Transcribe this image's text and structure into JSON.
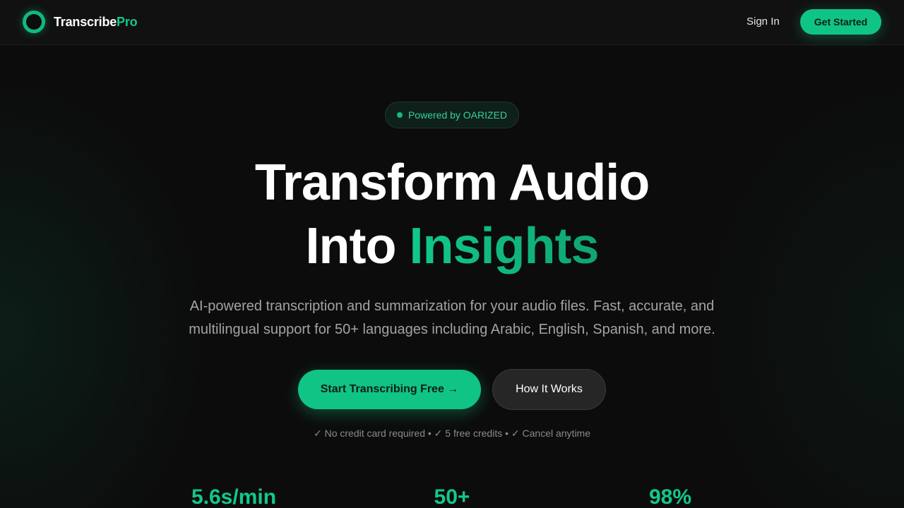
{
  "brand": {
    "name_main": "Transcribe",
    "name_accent": "Pro",
    "accent_color": "#10c485",
    "logo_icon": "ring-logo-icon"
  },
  "nav": {
    "sign_in": "Sign In",
    "get_started": "Get Started"
  },
  "hero": {
    "badge": "Powered by OARIZED",
    "headline_line1": "Transform Audio",
    "headline_line2_prefix": "Into ",
    "headline_line2_accent": "Insights",
    "subtitle": "AI-powered transcription and summarization for your audio files. Fast, accurate, and multilingual support for 50+ languages including Arabic, English, Spanish, and more.",
    "cta_primary": "Start Transcribing Free →",
    "cta_secondary": "How It Works",
    "perks": "✓ No credit card required • ✓ 5 free credits • ✓ Cancel anytime"
  },
  "stats": [
    {
      "value": "5.6s/min"
    },
    {
      "value": "50+"
    },
    {
      "value": "98%"
    }
  ]
}
